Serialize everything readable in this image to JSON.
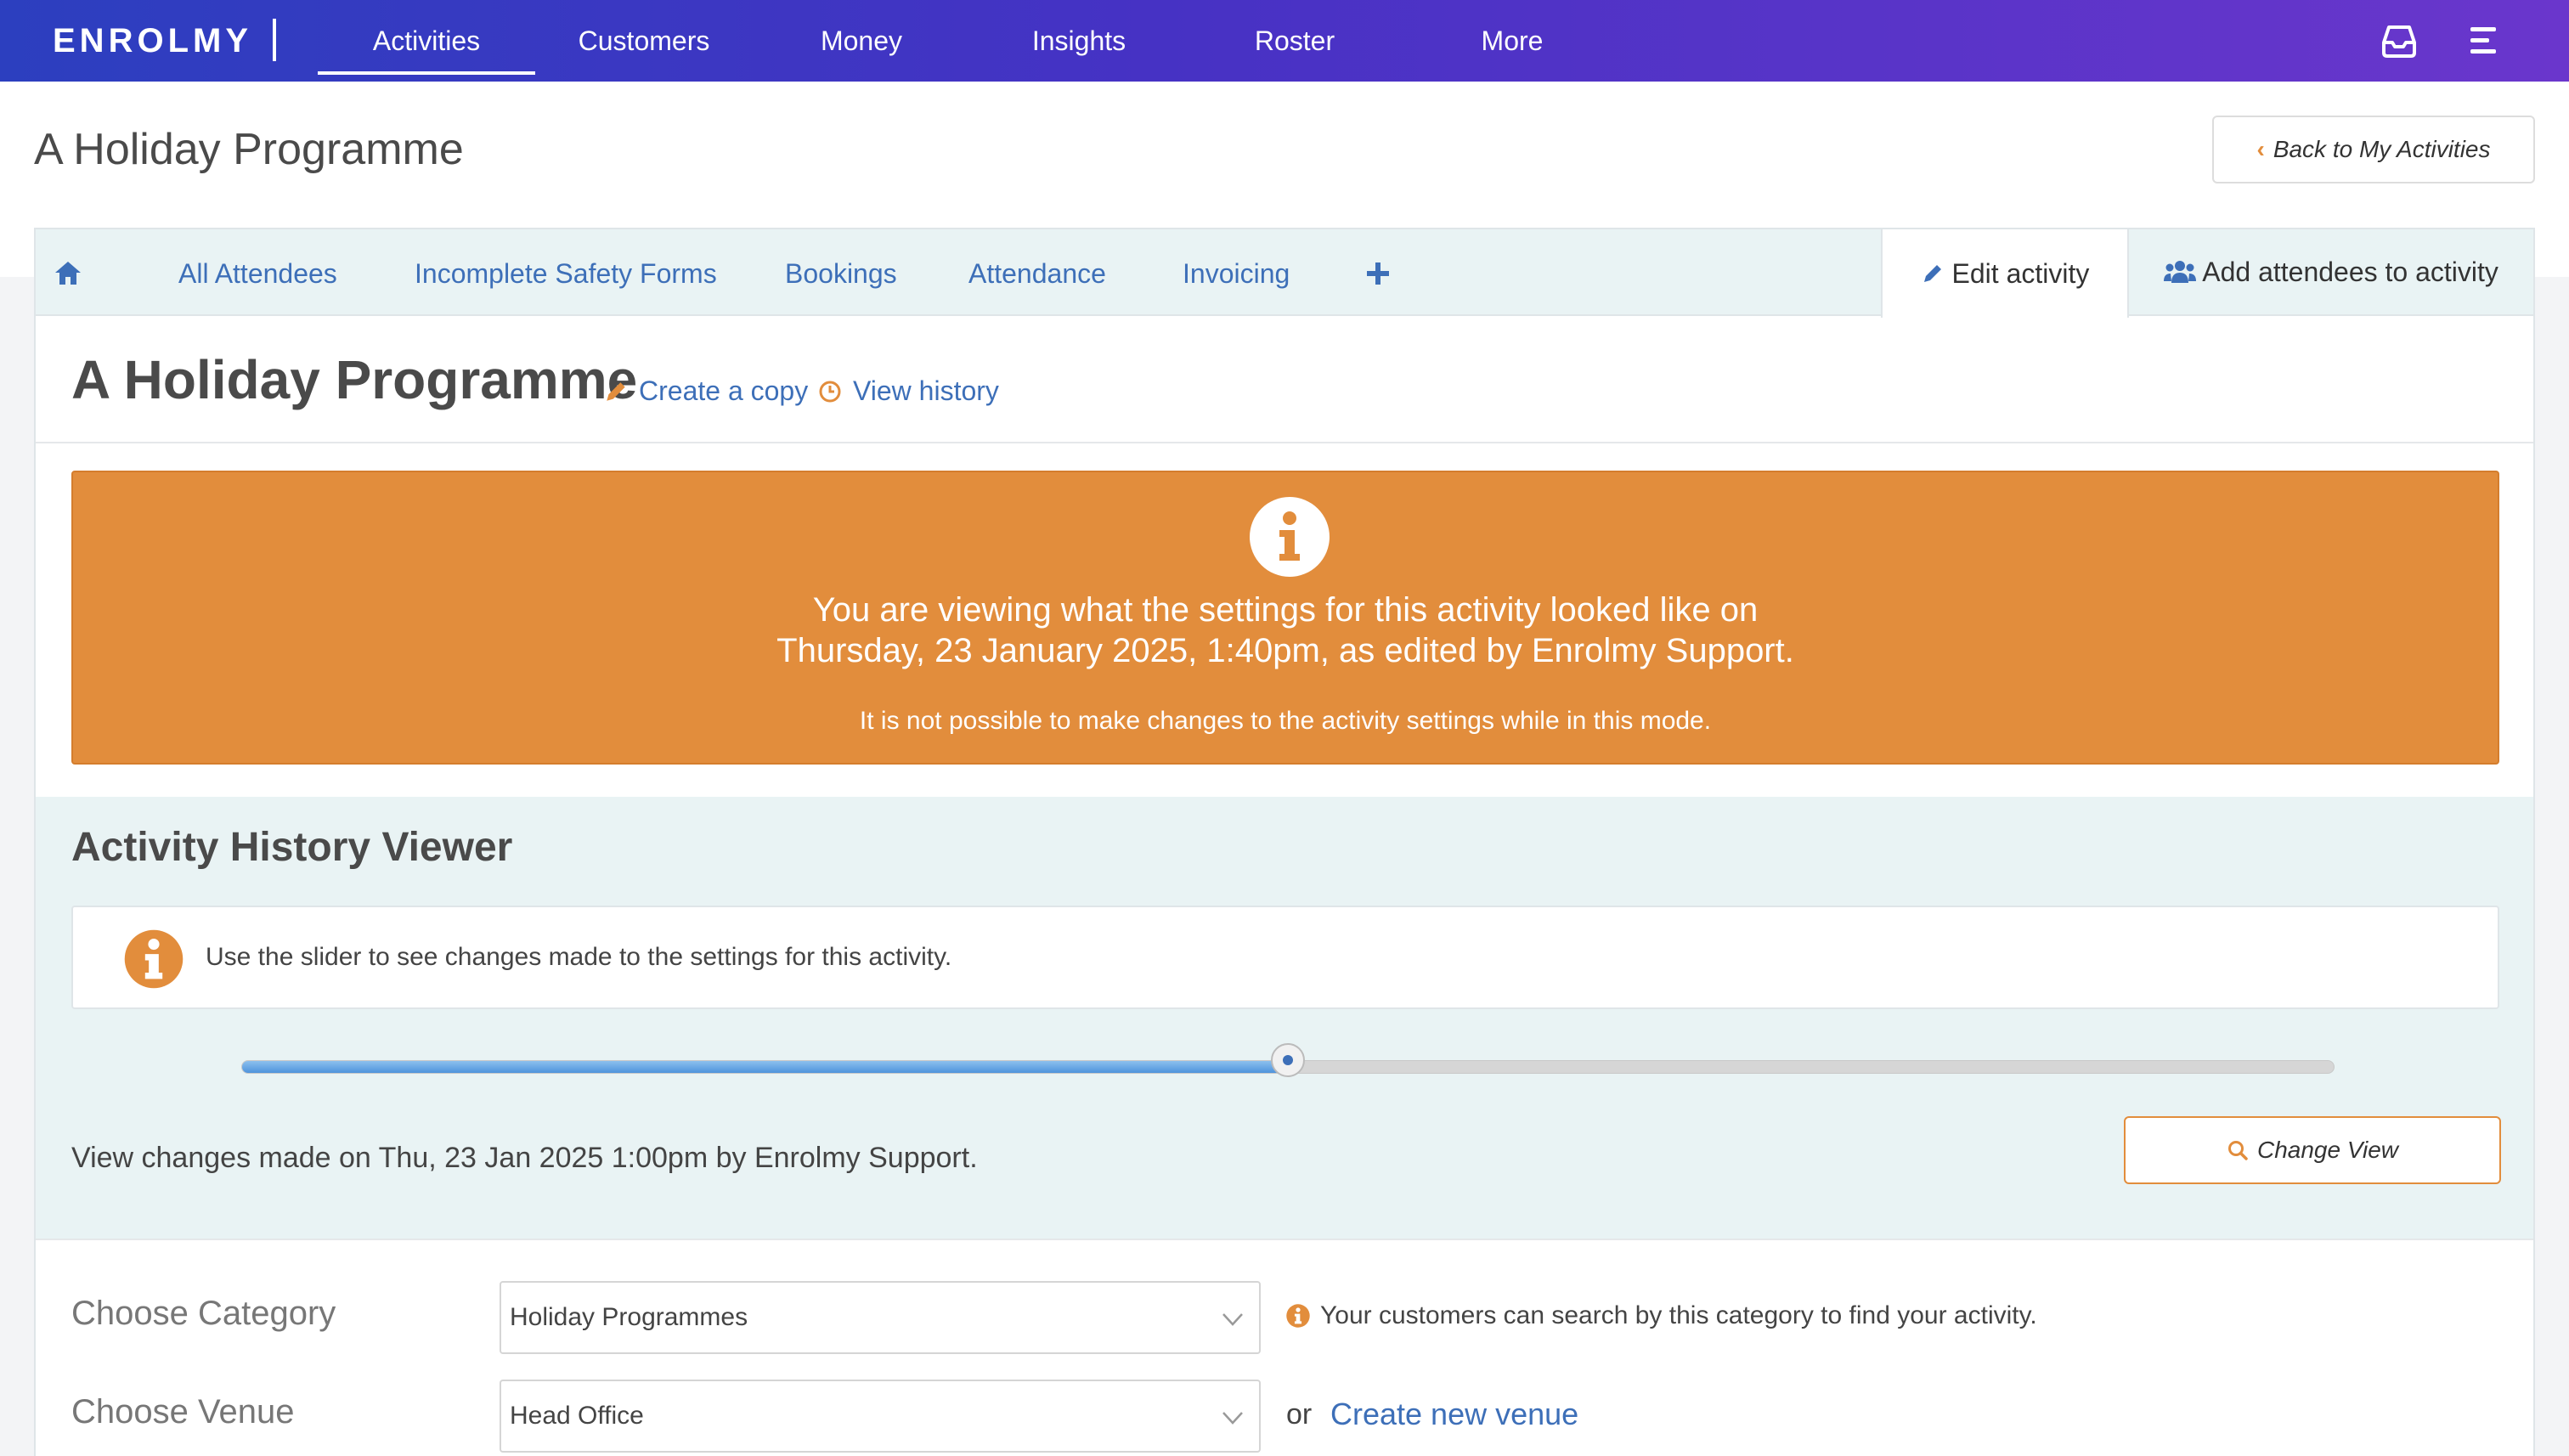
{
  "topnav": {
    "logo": "ENROLMY",
    "items": [
      "Activities",
      "Customers",
      "Money",
      "Insights",
      "Roster",
      "More"
    ],
    "active": "Activities",
    "icons": [
      "inbox-icon",
      "menu-icon"
    ]
  },
  "header": {
    "title": "A Holiday Programme",
    "back_label": "Back to My Activities"
  },
  "tabs": {
    "home_icon": "home-icon",
    "items": [
      "All Attendees",
      "Incomplete Safety Forms",
      "Bookings",
      "Attendance",
      "Invoicing"
    ],
    "add_icon": "plus-icon",
    "edit_activity": "Edit activity",
    "add_attendees": "Add attendees to activity"
  },
  "activity": {
    "title": "A Holiday Programme",
    "create_copy": "Create a copy",
    "view_history": "View history"
  },
  "alert": {
    "line1": "You are viewing what the settings for this activity looked like on",
    "line2": "Thursday, 23 January 2025, 1:40pm, as edited by Enrolmy Support.",
    "line3": "It is not possible to make changes to the activity settings while in this mode."
  },
  "history": {
    "title": "Activity History Viewer",
    "info": "Use the slider to see changes made to the settings for this activity.",
    "slider_fraction": 0.5,
    "summary": "View changes made on Thu, 23 Jan 2025 1:00pm by Enrolmy Support.",
    "change_view": "Change View"
  },
  "form": {
    "category_label": "Choose Category",
    "category_value": "Holiday Programmes",
    "category_hint": "Your customers can search by this category to find your activity.",
    "venue_label": "Choose Venue",
    "venue_value": "Head Office",
    "venue_or": "or",
    "venue_link": "Create new venue"
  },
  "colors": {
    "nav_start": "#2c3fbf",
    "nav_end": "#6a36cc",
    "accent_orange": "#e28d3c",
    "link_blue": "#3d6fb8",
    "panel_tint": "#e9f3f4"
  }
}
